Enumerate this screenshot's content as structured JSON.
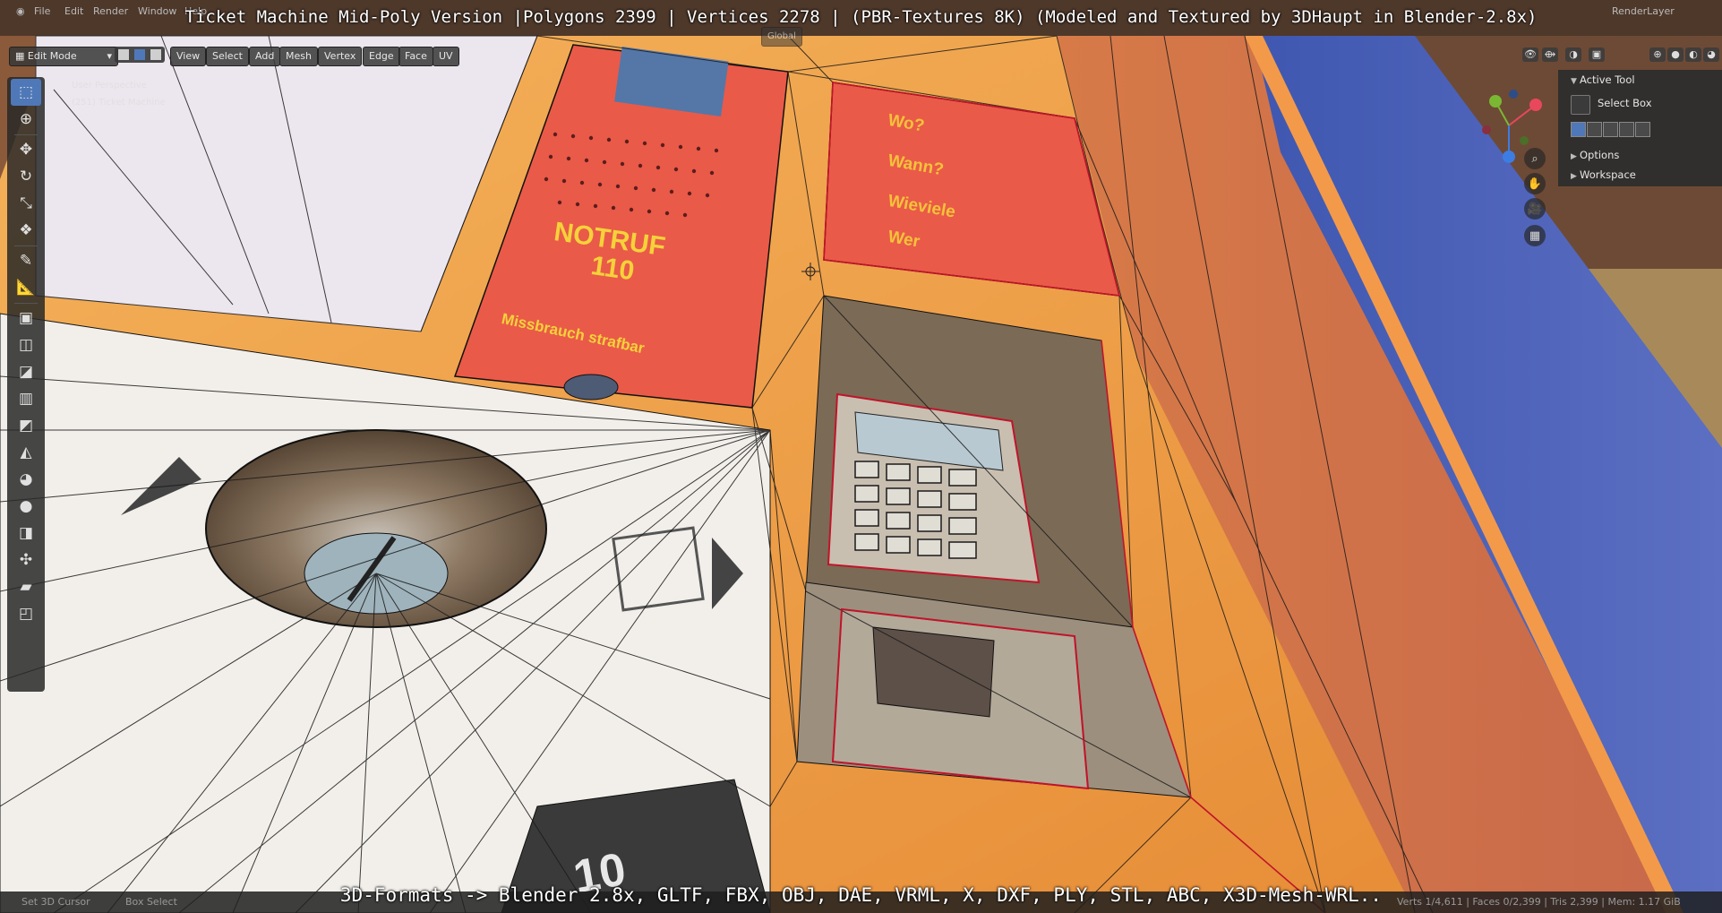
{
  "window": {
    "menus": [
      "File",
      "Edit",
      "Render",
      "Window",
      "Help"
    ]
  },
  "banner": {
    "top": "Ticket Machine Mid-Poly Version |Polygons 2399 | Vertices 2278 | (PBR-Textures 8K) (Modeled and Textured by 3DHaupt in Blender-2.8x)",
    "bottom": "3D-Formats -> Blender 2.8x, GLTF, FBX, OBJ, DAE, VRML, X, DXF, PLY, STL, ABC, X3D-Mesh-WRL.."
  },
  "header": {
    "mode": "Edit Mode",
    "menus": [
      "View",
      "Select",
      "Add",
      "Mesh",
      "Vertex",
      "Edge",
      "Face",
      "UV"
    ],
    "orientation": "Global"
  },
  "viewport": {
    "perspective": "User Perspective",
    "object": "(251) Ticket Machine"
  },
  "scene": {
    "emergency_title": "NOTRUF",
    "emergency_number": "110",
    "emergency_warning": "Missbrauch strafbar",
    "info_lines": [
      "Wo?",
      "Wann?",
      "Wieviele",
      "Wer"
    ],
    "bill_label": "10"
  },
  "toolbar": {
    "tools": [
      {
        "name": "select-box-tool",
        "glyph": "⬚",
        "active": true
      },
      {
        "name": "cursor-tool",
        "glyph": "⊕"
      },
      {
        "name": "move-tool",
        "glyph": "✥"
      },
      {
        "name": "rotate-tool",
        "glyph": "↻"
      },
      {
        "name": "scale-tool",
        "glyph": "⤡"
      },
      {
        "name": "transform-tool",
        "glyph": "❖"
      },
      {
        "name": "annotate-tool",
        "glyph": "✎"
      },
      {
        "name": "measure-tool",
        "glyph": "📐"
      },
      {
        "name": "extrude-tool",
        "glyph": "▣"
      },
      {
        "name": "inset-tool",
        "glyph": "◫"
      },
      {
        "name": "bevel-tool",
        "glyph": "◪"
      },
      {
        "name": "loop-cut-tool",
        "glyph": "▥"
      },
      {
        "name": "knife-tool",
        "glyph": "◩"
      },
      {
        "name": "poly-build-tool",
        "glyph": "◭"
      },
      {
        "name": "spin-tool",
        "glyph": "◕"
      },
      {
        "name": "smooth-tool",
        "glyph": "●"
      },
      {
        "name": "edge-slide-tool",
        "glyph": "◨"
      },
      {
        "name": "shrink-fatten-tool",
        "glyph": "✣"
      },
      {
        "name": "shear-tool",
        "glyph": "▰"
      },
      {
        "name": "rip-tool",
        "glyph": "◰"
      }
    ]
  },
  "npanel": {
    "active_tool_label": "Active Tool",
    "select_box_label": "Select Box",
    "options_label": "Options",
    "workspace_label": "Workspace"
  },
  "topbar_right": {
    "render_layer": "RenderLayer"
  },
  "statusbar": {
    "left": [
      "Set 3D Cursor",
      "Box Select"
    ],
    "right": "Verts 1/4,611 | Faces 0/2,399 | Tris 2,399 | Mem: 1.17 GiB"
  },
  "colors": {
    "accent": "#4f78b8",
    "orange_body": "#e99a3d",
    "red_panel": "#e8584a",
    "blue_side": "#4f63b5",
    "wire_black": "#1a1a1a",
    "wire_red": "#c0142a"
  }
}
